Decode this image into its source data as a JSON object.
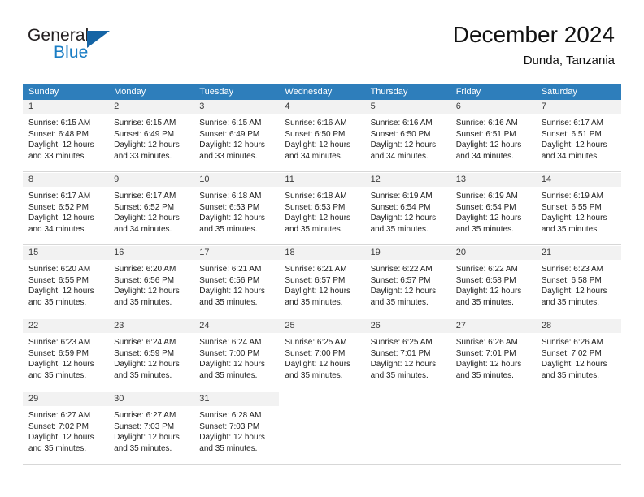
{
  "brand": {
    "name_top": "General",
    "name_bottom": "Blue",
    "accent_color": "#1464a5",
    "text_color": "#231f20"
  },
  "header": {
    "title": "December 2024",
    "subtitle": "Dunda, Tanzania"
  },
  "theme": {
    "header_row_bg": "#2e7ebb",
    "header_row_text": "#ffffff",
    "daynum_bg": "#f2f2f2",
    "cell_bg": "#ffffff",
    "row_divider": "#d7d7d7"
  },
  "weekdays": [
    "Sunday",
    "Monday",
    "Tuesday",
    "Wednesday",
    "Thursday",
    "Friday",
    "Saturday"
  ],
  "weeks": [
    [
      {
        "day": "1",
        "sunrise": "Sunrise: 6:15 AM",
        "sunset": "Sunset: 6:48 PM",
        "daylight1": "Daylight: 12 hours",
        "daylight2": "and 33 minutes."
      },
      {
        "day": "2",
        "sunrise": "Sunrise: 6:15 AM",
        "sunset": "Sunset: 6:49 PM",
        "daylight1": "Daylight: 12 hours",
        "daylight2": "and 33 minutes."
      },
      {
        "day": "3",
        "sunrise": "Sunrise: 6:15 AM",
        "sunset": "Sunset: 6:49 PM",
        "daylight1": "Daylight: 12 hours",
        "daylight2": "and 33 minutes."
      },
      {
        "day": "4",
        "sunrise": "Sunrise: 6:16 AM",
        "sunset": "Sunset: 6:50 PM",
        "daylight1": "Daylight: 12 hours",
        "daylight2": "and 34 minutes."
      },
      {
        "day": "5",
        "sunrise": "Sunrise: 6:16 AM",
        "sunset": "Sunset: 6:50 PM",
        "daylight1": "Daylight: 12 hours",
        "daylight2": "and 34 minutes."
      },
      {
        "day": "6",
        "sunrise": "Sunrise: 6:16 AM",
        "sunset": "Sunset: 6:51 PM",
        "daylight1": "Daylight: 12 hours",
        "daylight2": "and 34 minutes."
      },
      {
        "day": "7",
        "sunrise": "Sunrise: 6:17 AM",
        "sunset": "Sunset: 6:51 PM",
        "daylight1": "Daylight: 12 hours",
        "daylight2": "and 34 minutes."
      }
    ],
    [
      {
        "day": "8",
        "sunrise": "Sunrise: 6:17 AM",
        "sunset": "Sunset: 6:52 PM",
        "daylight1": "Daylight: 12 hours",
        "daylight2": "and 34 minutes."
      },
      {
        "day": "9",
        "sunrise": "Sunrise: 6:17 AM",
        "sunset": "Sunset: 6:52 PM",
        "daylight1": "Daylight: 12 hours",
        "daylight2": "and 34 minutes."
      },
      {
        "day": "10",
        "sunrise": "Sunrise: 6:18 AM",
        "sunset": "Sunset: 6:53 PM",
        "daylight1": "Daylight: 12 hours",
        "daylight2": "and 35 minutes."
      },
      {
        "day": "11",
        "sunrise": "Sunrise: 6:18 AM",
        "sunset": "Sunset: 6:53 PM",
        "daylight1": "Daylight: 12 hours",
        "daylight2": "and 35 minutes."
      },
      {
        "day": "12",
        "sunrise": "Sunrise: 6:19 AM",
        "sunset": "Sunset: 6:54 PM",
        "daylight1": "Daylight: 12 hours",
        "daylight2": "and 35 minutes."
      },
      {
        "day": "13",
        "sunrise": "Sunrise: 6:19 AM",
        "sunset": "Sunset: 6:54 PM",
        "daylight1": "Daylight: 12 hours",
        "daylight2": "and 35 minutes."
      },
      {
        "day": "14",
        "sunrise": "Sunrise: 6:19 AM",
        "sunset": "Sunset: 6:55 PM",
        "daylight1": "Daylight: 12 hours",
        "daylight2": "and 35 minutes."
      }
    ],
    [
      {
        "day": "15",
        "sunrise": "Sunrise: 6:20 AM",
        "sunset": "Sunset: 6:55 PM",
        "daylight1": "Daylight: 12 hours",
        "daylight2": "and 35 minutes."
      },
      {
        "day": "16",
        "sunrise": "Sunrise: 6:20 AM",
        "sunset": "Sunset: 6:56 PM",
        "daylight1": "Daylight: 12 hours",
        "daylight2": "and 35 minutes."
      },
      {
        "day": "17",
        "sunrise": "Sunrise: 6:21 AM",
        "sunset": "Sunset: 6:56 PM",
        "daylight1": "Daylight: 12 hours",
        "daylight2": "and 35 minutes."
      },
      {
        "day": "18",
        "sunrise": "Sunrise: 6:21 AM",
        "sunset": "Sunset: 6:57 PM",
        "daylight1": "Daylight: 12 hours",
        "daylight2": "and 35 minutes."
      },
      {
        "day": "19",
        "sunrise": "Sunrise: 6:22 AM",
        "sunset": "Sunset: 6:57 PM",
        "daylight1": "Daylight: 12 hours",
        "daylight2": "and 35 minutes."
      },
      {
        "day": "20",
        "sunrise": "Sunrise: 6:22 AM",
        "sunset": "Sunset: 6:58 PM",
        "daylight1": "Daylight: 12 hours",
        "daylight2": "and 35 minutes."
      },
      {
        "day": "21",
        "sunrise": "Sunrise: 6:23 AM",
        "sunset": "Sunset: 6:58 PM",
        "daylight1": "Daylight: 12 hours",
        "daylight2": "and 35 minutes."
      }
    ],
    [
      {
        "day": "22",
        "sunrise": "Sunrise: 6:23 AM",
        "sunset": "Sunset: 6:59 PM",
        "daylight1": "Daylight: 12 hours",
        "daylight2": "and 35 minutes."
      },
      {
        "day": "23",
        "sunrise": "Sunrise: 6:24 AM",
        "sunset": "Sunset: 6:59 PM",
        "daylight1": "Daylight: 12 hours",
        "daylight2": "and 35 minutes."
      },
      {
        "day": "24",
        "sunrise": "Sunrise: 6:24 AM",
        "sunset": "Sunset: 7:00 PM",
        "daylight1": "Daylight: 12 hours",
        "daylight2": "and 35 minutes."
      },
      {
        "day": "25",
        "sunrise": "Sunrise: 6:25 AM",
        "sunset": "Sunset: 7:00 PM",
        "daylight1": "Daylight: 12 hours",
        "daylight2": "and 35 minutes."
      },
      {
        "day": "26",
        "sunrise": "Sunrise: 6:25 AM",
        "sunset": "Sunset: 7:01 PM",
        "daylight1": "Daylight: 12 hours",
        "daylight2": "and 35 minutes."
      },
      {
        "day": "27",
        "sunrise": "Sunrise: 6:26 AM",
        "sunset": "Sunset: 7:01 PM",
        "daylight1": "Daylight: 12 hours",
        "daylight2": "and 35 minutes."
      },
      {
        "day": "28",
        "sunrise": "Sunrise: 6:26 AM",
        "sunset": "Sunset: 7:02 PM",
        "daylight1": "Daylight: 12 hours",
        "daylight2": "and 35 minutes."
      }
    ],
    [
      {
        "day": "29",
        "sunrise": "Sunrise: 6:27 AM",
        "sunset": "Sunset: 7:02 PM",
        "daylight1": "Daylight: 12 hours",
        "daylight2": "and 35 minutes."
      },
      {
        "day": "30",
        "sunrise": "Sunrise: 6:27 AM",
        "sunset": "Sunset: 7:03 PM",
        "daylight1": "Daylight: 12 hours",
        "daylight2": "and 35 minutes."
      },
      {
        "day": "31",
        "sunrise": "Sunrise: 6:28 AM",
        "sunset": "Sunset: 7:03 PM",
        "daylight1": "Daylight: 12 hours",
        "daylight2": "and 35 minutes."
      },
      {
        "day": "",
        "sunrise": "",
        "sunset": "",
        "daylight1": "",
        "daylight2": ""
      },
      {
        "day": "",
        "sunrise": "",
        "sunset": "",
        "daylight1": "",
        "daylight2": ""
      },
      {
        "day": "",
        "sunrise": "",
        "sunset": "",
        "daylight1": "",
        "daylight2": ""
      },
      {
        "day": "",
        "sunrise": "",
        "sunset": "",
        "daylight1": "",
        "daylight2": ""
      }
    ]
  ]
}
